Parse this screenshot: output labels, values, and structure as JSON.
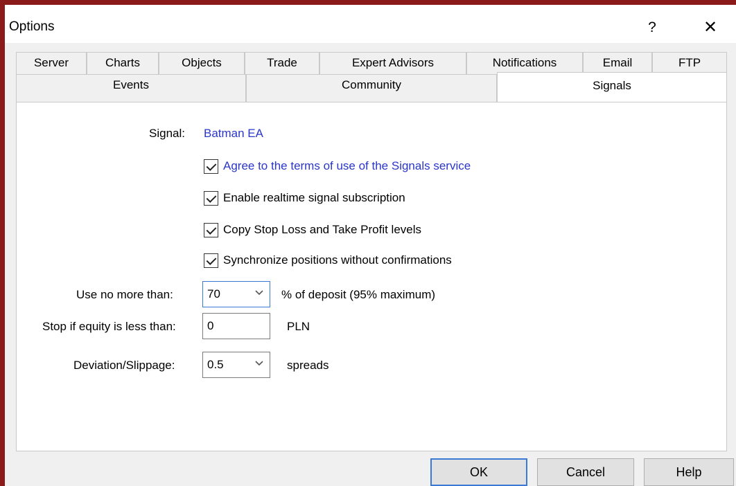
{
  "window": {
    "title": "Options"
  },
  "titlebar": {
    "help_glyph": "?",
    "close_glyph": "✕"
  },
  "tabs_row1": [
    "Server",
    "Charts",
    "Objects",
    "Trade",
    "Expert Advisors",
    "Notifications",
    "Email",
    "FTP"
  ],
  "tabs_row2": [
    "Events",
    "Community",
    "Signals"
  ],
  "active_tab": "Signals",
  "signals": {
    "signal_label": "Signal:",
    "signal_value": "Batman EA",
    "checkboxes": [
      {
        "label": "Agree to the terms of use of the Signals service",
        "checked": true
      },
      {
        "label": "Enable realtime signal subscription",
        "checked": true
      },
      {
        "label": "Copy Stop Loss and Take Profit levels",
        "checked": true
      },
      {
        "label": "Synchronize positions without confirmations",
        "checked": true
      }
    ],
    "use_no_more_label": "Use no more than:",
    "use_no_more_value": "70",
    "use_no_more_suffix": "% of deposit (95% maximum)",
    "stop_equity_label": "Stop if equity is less than:",
    "stop_equity_value": "0",
    "stop_equity_suffix": "PLN",
    "deviation_label": "Deviation/Slippage:",
    "deviation_value": "0.5",
    "deviation_suffix": "spreads"
  },
  "buttons": {
    "ok": "OK",
    "cancel": "Cancel",
    "help": "Help"
  },
  "colors": {
    "link": "#2a36c8",
    "frame": "#8b1a1a",
    "focus": "#3a7ad6"
  }
}
